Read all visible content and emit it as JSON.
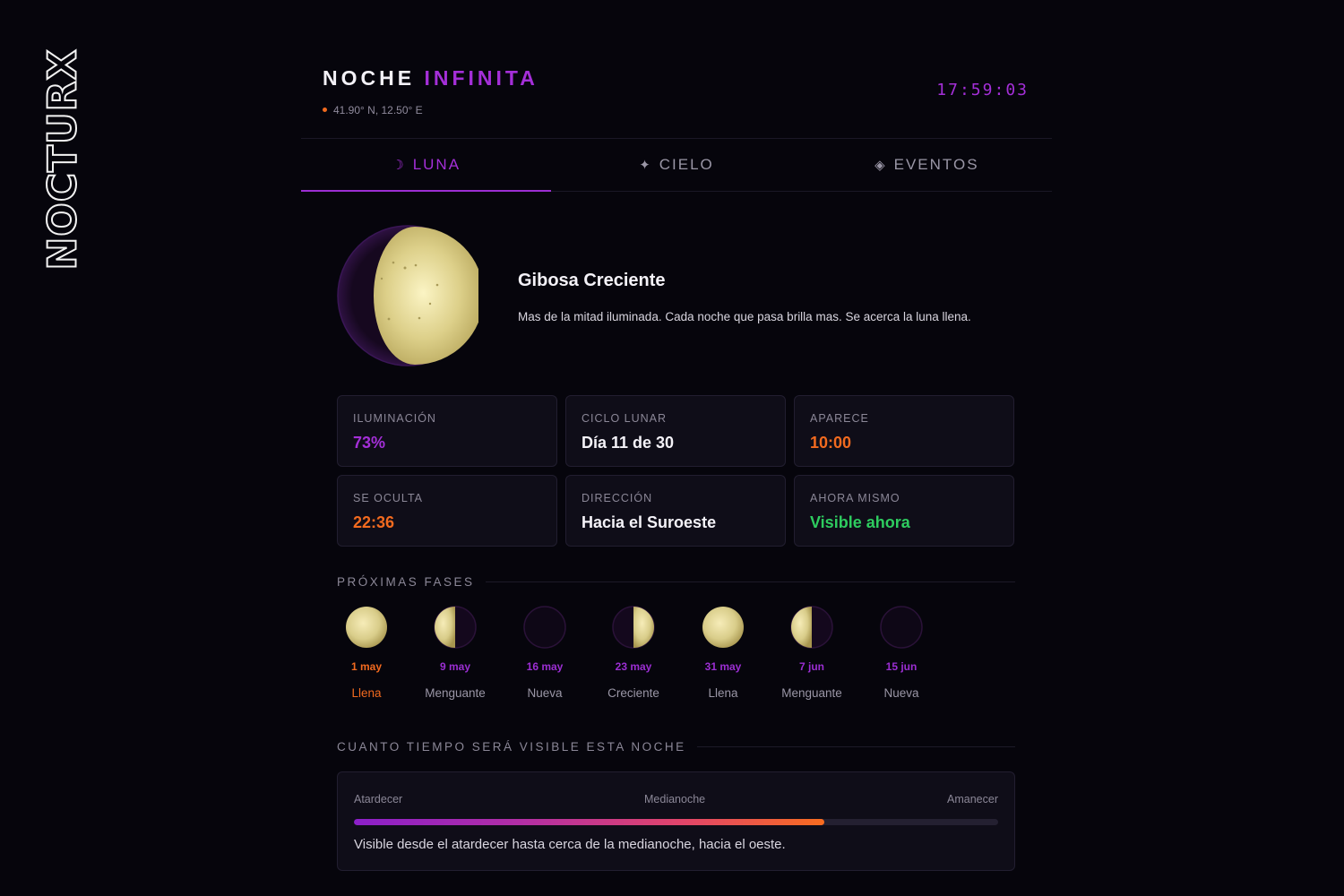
{
  "brand": "NOCTURX",
  "header": {
    "title_part1": "NOCHE",
    "title_part2": "INFINITA",
    "coords": "41.90° N, 12.50° E",
    "clock": "17:59:03"
  },
  "tabs": [
    {
      "icon": "☽",
      "label": "LUNA",
      "active": true
    },
    {
      "icon": "✦",
      "label": "CIELO",
      "active": false
    },
    {
      "icon": "◈",
      "label": "EVENTOS",
      "active": false
    }
  ],
  "moon": {
    "phase_name": "Gibosa Creciente",
    "description": "Mas de la mitad iluminada. Cada noche que pasa brilla mas. Se acerca la luna llena."
  },
  "stats": [
    {
      "label": "ILUMINACIÓN",
      "value": "73%",
      "color": "#a42fd8"
    },
    {
      "label": "CICLO LUNAR",
      "value": "Día 11 de 30",
      "color": "#f4f2f8"
    },
    {
      "label": "APARECE",
      "value": "10:00",
      "color": "#f26a1f"
    },
    {
      "label": "SE OCULTA",
      "value": "22:36",
      "color": "#f26a1f"
    },
    {
      "label": "DIRECCIÓN",
      "value": "Hacia el Suroeste",
      "color": "#f4f2f8"
    },
    {
      "label": "AHORA MISMO",
      "value": "Visible ahora",
      "color": "#2ecc5f"
    }
  ],
  "upcoming": {
    "title": "PRÓXIMAS FASES",
    "phases": [
      {
        "date": "1 may",
        "name": "Llena",
        "type": "full"
      },
      {
        "date": "9 may",
        "name": "Menguante",
        "type": "left-lit"
      },
      {
        "date": "16 may",
        "name": "Nueva",
        "type": "new"
      },
      {
        "date": "23 may",
        "name": "Creciente",
        "type": "right-lit"
      },
      {
        "date": "31 may",
        "name": "Llena",
        "type": "full"
      },
      {
        "date": "7 jun",
        "name": "Menguante",
        "type": "left-lit"
      },
      {
        "date": "15 jun",
        "name": "Nueva",
        "type": "new"
      }
    ]
  },
  "visibility": {
    "title": "CUANTO TIEMPO SERÁ VISIBLE ESTA NOCHE",
    "start_label": "Atardecer",
    "mid_label": "Medianoche",
    "end_label": "Amanecer",
    "progress_fraction": 0.73,
    "text": "Visible desde el atardecer hasta cerca de la medianoche, hacia el oeste."
  },
  "colors": {
    "accent_purple": "#a42fd8",
    "accent_orange": "#f26a1f",
    "visible_green": "#2ecc5f",
    "moon_gold": "#d9cd8a"
  }
}
